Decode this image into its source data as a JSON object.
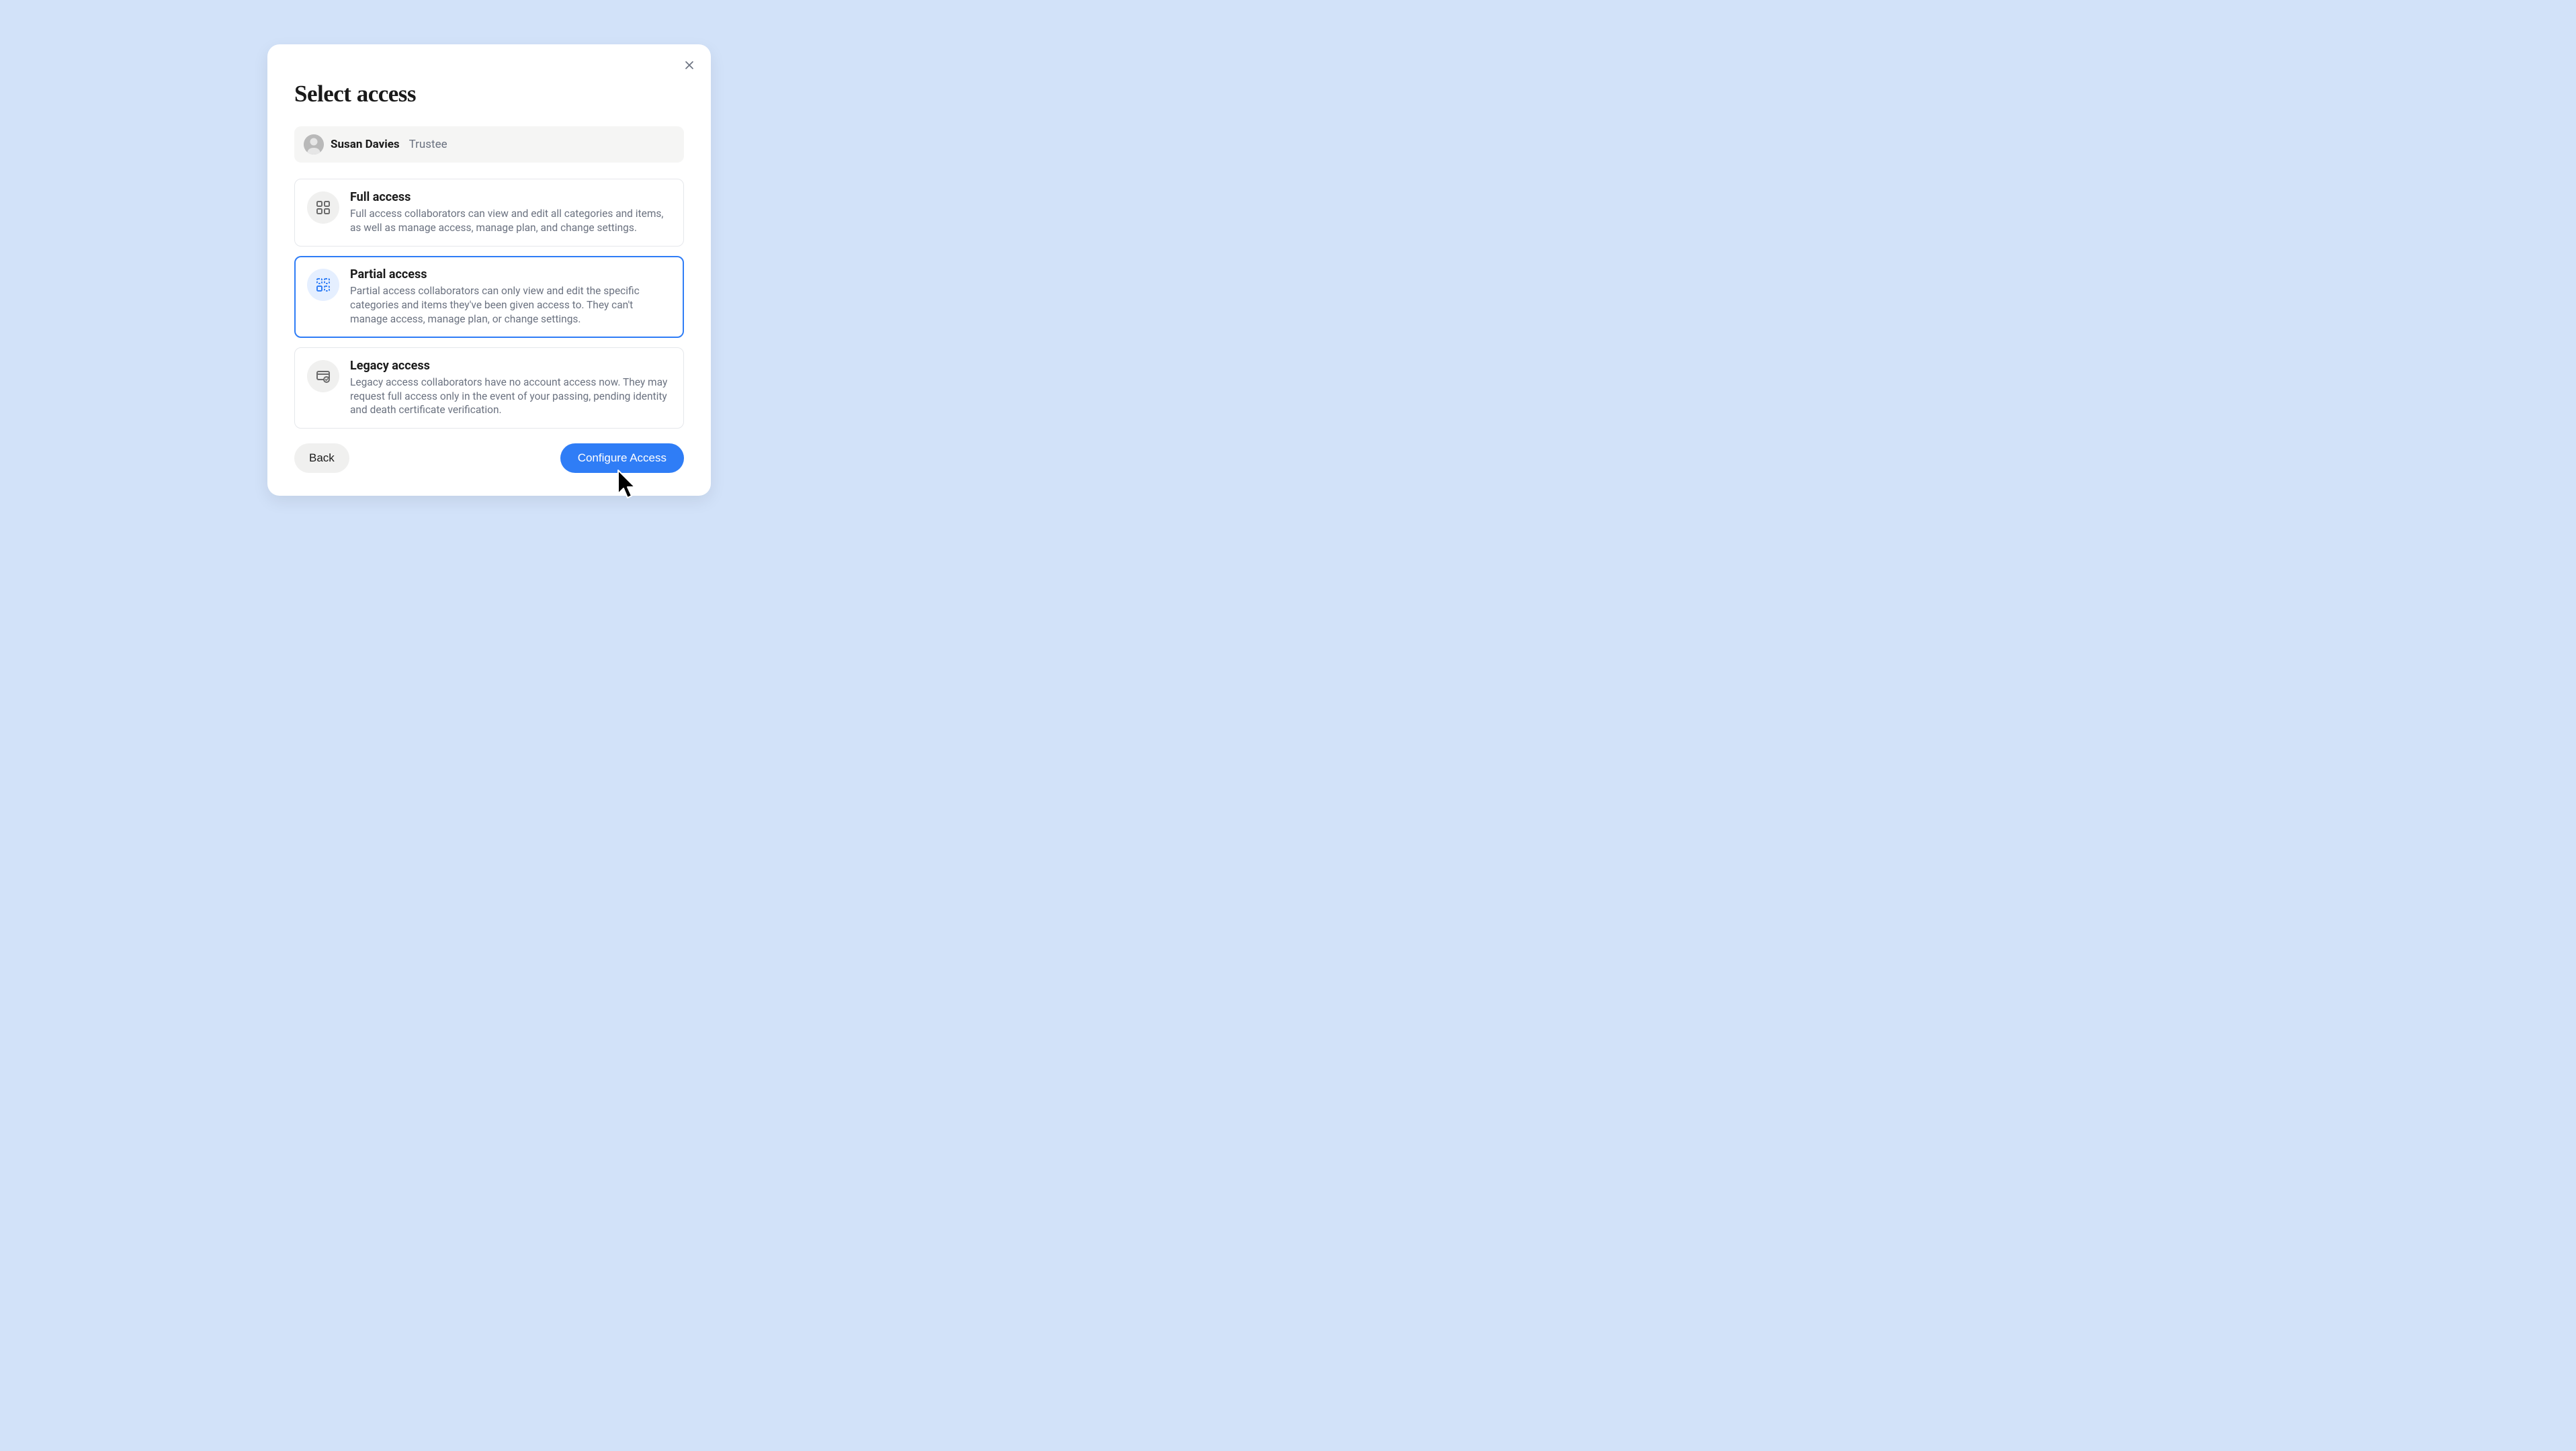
{
  "modal": {
    "title": "Select access"
  },
  "user": {
    "name": "Susan Davies",
    "role": "Trustee"
  },
  "options": [
    {
      "title": "Full access",
      "desc": "Full access collaborators can view and edit all categories and items, as well as manage access, manage plan, and change settings.",
      "selected": false
    },
    {
      "title": "Partial access",
      "desc": "Partial access collaborators can only view and edit the specific categories and items they've been given access to. They can't manage access, manage plan, or change settings.",
      "selected": true
    },
    {
      "title": "Legacy access",
      "desc": "Legacy access collaborators have no account access now. They may request full access only in the event of your passing, pending identity and death certificate verification.",
      "selected": false
    }
  ],
  "buttons": {
    "back": "Back",
    "primary": "Configure Access"
  }
}
